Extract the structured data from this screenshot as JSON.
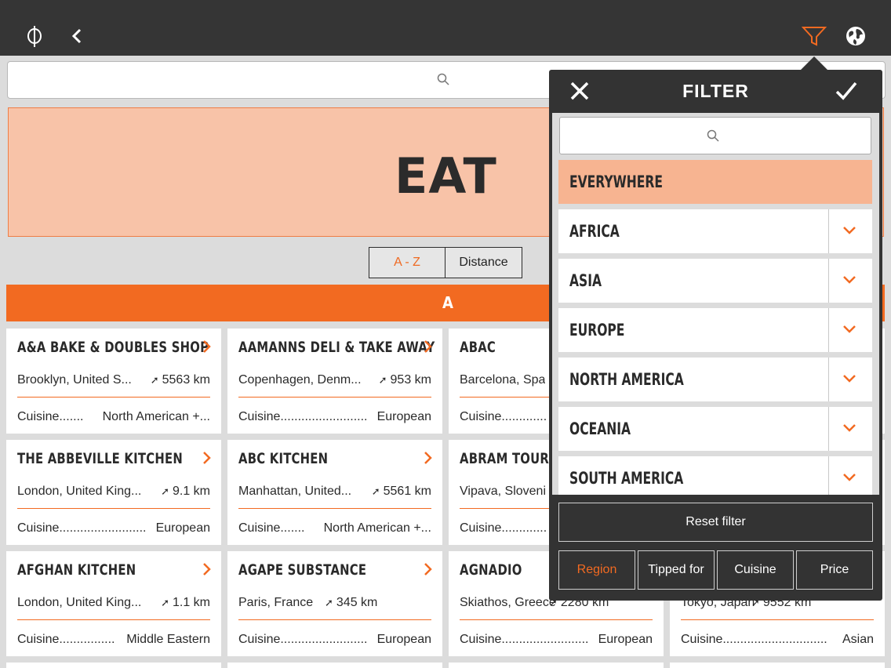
{
  "topbar": {
    "logo_icon": "phi-logo-icon",
    "back_icon": "chevron-left-icon",
    "filter_icon": "funnel-icon",
    "globe_icon": "globe-icon"
  },
  "search": {
    "placeholder": ""
  },
  "hero": {
    "title": "EAT"
  },
  "sort": {
    "az_label": "A - Z",
    "distance_label": "Distance"
  },
  "section_letter": "A",
  "cards": [
    {
      "name": "A&A BAKE & DOUBLES SHOP",
      "location": "Brooklyn, United S...",
      "distance": "5563 km",
      "cuisine_label": "Cuisine.......",
      "cuisine": "North American +..."
    },
    {
      "name": "AAMANNS DELI & TAKE AWAY",
      "location": "Copenhagen, Denm...",
      "distance": "953 km",
      "cuisine_label": "Cuisine.........................",
      "cuisine": "European"
    },
    {
      "name": "ABAC",
      "location": "Barcelona, Spa",
      "distance": "",
      "cuisine_label": "Cuisine.............",
      "cuisine": ""
    },
    {
      "name": "THE ABBEVILLE KITCHEN",
      "location": "London, United King...",
      "distance": "9.1 km",
      "cuisine_label": "Cuisine.........................",
      "cuisine": "European"
    },
    {
      "name": "ABC KITCHEN",
      "location": "Manhattan, United...",
      "distance": "5561 km",
      "cuisine_label": "Cuisine.......",
      "cuisine": "North American +..."
    },
    {
      "name": "ABRAM TOURIST",
      "location": "Vipava, Sloveni",
      "distance": "",
      "cuisine_label": "Cuisine.............",
      "cuisine": ""
    },
    {
      "name": "AFGHAN KITCHEN",
      "location": "London, United King...",
      "distance": "1.1 km",
      "cuisine_label": "Cuisine................",
      "cuisine": "Middle Eastern"
    },
    {
      "name": "AGAPE SUBSTANCE",
      "location": "Paris, France",
      "distance": "345 km",
      "cuisine_label": "Cuisine.........................",
      "cuisine": "European"
    },
    {
      "name": "AGNADIO",
      "location": "Skiathos, Greece",
      "distance": "2280 km",
      "cuisine_label": "Cuisine.........................",
      "cuisine": "European"
    },
    {
      "name": "",
      "location": "Tokyo, Japan",
      "distance": "9552 km",
      "cuisine_label": "Cuisine..............................",
      "cuisine": "Asian"
    }
  ],
  "filter": {
    "title": "FILTER",
    "close_icon": "close-icon",
    "confirm_icon": "check-icon",
    "search_placeholder": "",
    "regions": [
      "EVERYWHERE",
      "AFRICA",
      "ASIA",
      "EUROPE",
      "NORTH AMERICA",
      "OCEANIA",
      "SOUTH AMERICA"
    ],
    "reset_label": "Reset filter",
    "tabs": [
      "Region",
      "Tipped for",
      "Cuisine",
      "Price"
    ],
    "active_tab": "Region"
  },
  "colors": {
    "accent": "#f26a21",
    "hero_bg": "#f8c3a8",
    "selected_region_bg": "#f7b491",
    "topbar_bg": "#353535"
  }
}
